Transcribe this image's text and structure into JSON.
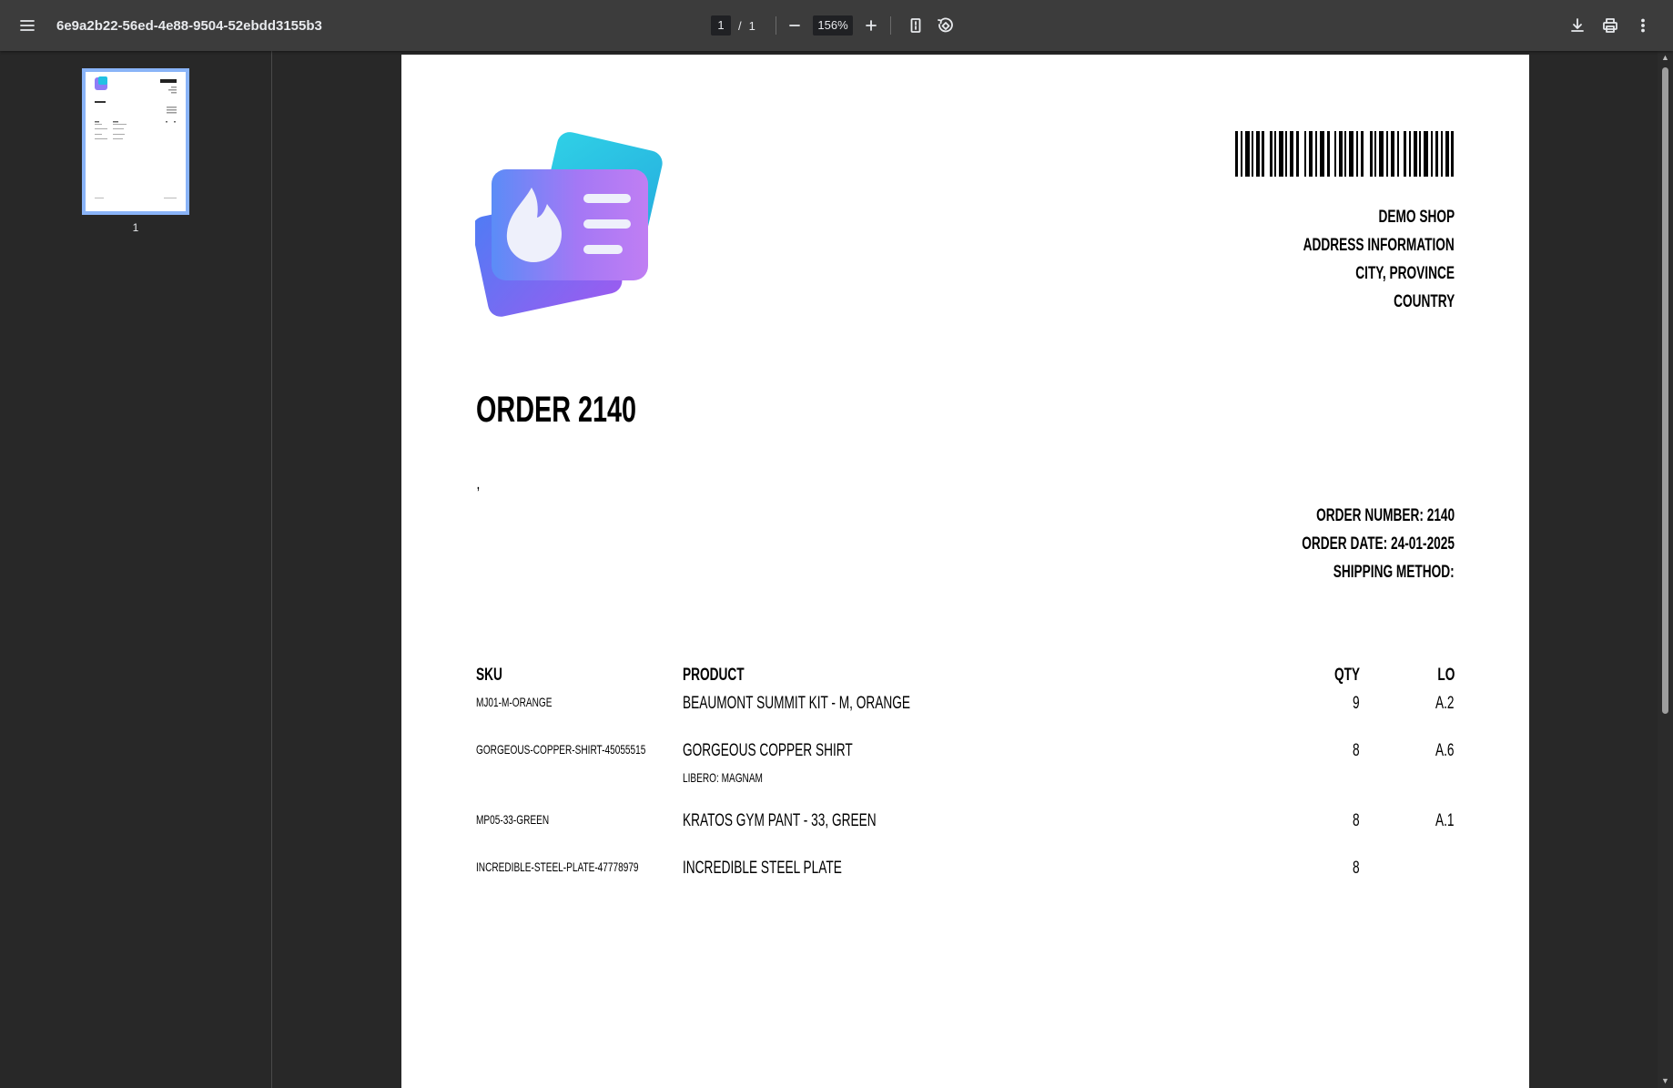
{
  "toolbar": {
    "doc_title": "6e9a2b22-56ed-4e88-9504-52ebdd3155b3",
    "page_current": "1",
    "page_separator": "/",
    "page_total": "1",
    "zoom": "156%"
  },
  "sidebar": {
    "thumbnail_page_number": "1"
  },
  "document": {
    "shop": {
      "name": "DEMO SHOP",
      "address": "ADDRESS INFORMATION",
      "city": "CITY, PROVINCE",
      "country": "COUNTRY"
    },
    "title": "ORDER 2140",
    "customer_line": ",",
    "order_meta": {
      "number": "ORDER NUMBER: 2140",
      "date": "ORDER DATE: 24-01-2025",
      "shipping": "SHIPPING METHOD:"
    },
    "table": {
      "headers": {
        "sku": "SKU",
        "product": "PRODUCT",
        "qty": "QTY",
        "location": "LO"
      },
      "rows": [
        {
          "sku": "MJ01-M-ORANGE",
          "product": "BEAUMONT SUMMIT KIT - M, ORANGE",
          "option": "",
          "qty": "9",
          "location": "A.2"
        },
        {
          "sku": "GORGEOUS-COPPER-SHIRT-45055515",
          "product": "GORGEOUS COPPER SHIRT",
          "option": "LIBERO: MAGNAM",
          "qty": "8",
          "location": "A.6"
        },
        {
          "sku": "MP05-33-GREEN",
          "product": "KRATOS GYM PANT - 33, GREEN",
          "option": "",
          "qty": "8",
          "location": "A.1"
        },
        {
          "sku": "INCREDIBLE-STEEL-PLATE-47778979",
          "product": "INCREDIBLE STEEL PLATE",
          "option": "",
          "qty": "8",
          "location": ""
        }
      ]
    }
  },
  "colors": {
    "toolbar_bg": "#3c3c3c",
    "viewer_bg": "#282828",
    "thumbnail_border": "#8ab4f8"
  }
}
